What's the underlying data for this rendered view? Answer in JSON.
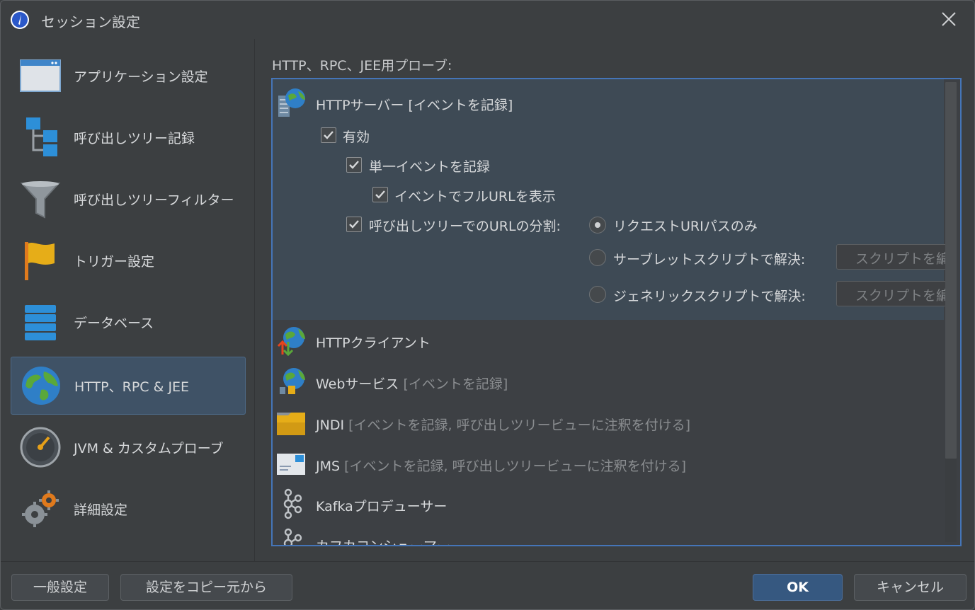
{
  "window": {
    "title": "セッション設定"
  },
  "sidebar": {
    "items": [
      {
        "label": "アプリケーション設定",
        "icon": "application-window-icon"
      },
      {
        "label": "呼び出しツリー記録",
        "icon": "call-tree-icon"
      },
      {
        "label": "呼び出しツリーフィルター",
        "icon": "funnel-filter-icon"
      },
      {
        "label": "トリガー設定",
        "icon": "flag-icon"
      },
      {
        "label": "データベース",
        "icon": "database-icon"
      },
      {
        "label": "HTTP、RPC & JEE",
        "icon": "globe-icon",
        "selected": true
      },
      {
        "label": "JVM & カスタムプローブ",
        "icon": "gauge-icon"
      },
      {
        "label": "詳細設定",
        "icon": "gears-icon"
      }
    ]
  },
  "main": {
    "section_label": "HTTP、RPC、JEE用プローブ:",
    "probes": [
      {
        "name": "HTTPサーバー",
        "suffix": " [イベントを記録]",
        "icon": "http-server-icon"
      },
      {
        "name": "HTTPクライアント",
        "suffix": "",
        "icon": "http-client-icon"
      },
      {
        "name": "Webサービス",
        "suffix": " [イベントを記録]",
        "icon": "web-service-icon"
      },
      {
        "name": "JNDI",
        "suffix": " [イベントを記録, 呼び出しツリービューに注釈を付ける]",
        "icon": "jndi-folder-icon"
      },
      {
        "name": "JMS",
        "suffix": " [イベントを記録, 呼び出しツリービューに注釈を付ける]",
        "icon": "jms-message-icon"
      },
      {
        "name": "Kafkaプロデューサー",
        "suffix": "",
        "icon": "kafka-icon"
      },
      {
        "name": "カフカコンシューマー",
        "suffix": "",
        "icon": "kafka-icon"
      }
    ],
    "http_server": {
      "enabled_label": "有効",
      "single_event_label": "単一イベントを記録",
      "full_url_label": "イベントでフルURLを表示",
      "split_label": "呼び出しツリーでのURLの分割:",
      "radio_options": [
        {
          "label": "リクエストURIパスのみ",
          "selected": true
        },
        {
          "label": "サーブレットスクリプトで解決:",
          "selected": false,
          "button": "スクリプトを編集"
        },
        {
          "label": "ジェネリックスクリプトで解決:",
          "selected": false,
          "button": "スクリプトを編集"
        }
      ]
    }
  },
  "footer": {
    "general_settings": "一般設定",
    "copy_settings": "設定をコピー元から",
    "ok": "OK",
    "cancel": "キャンセル"
  },
  "colors": {
    "background": "#3c3f41",
    "selected_nav": "#3f5266",
    "panel_border": "#4575b8",
    "primary_button": "#365880"
  }
}
